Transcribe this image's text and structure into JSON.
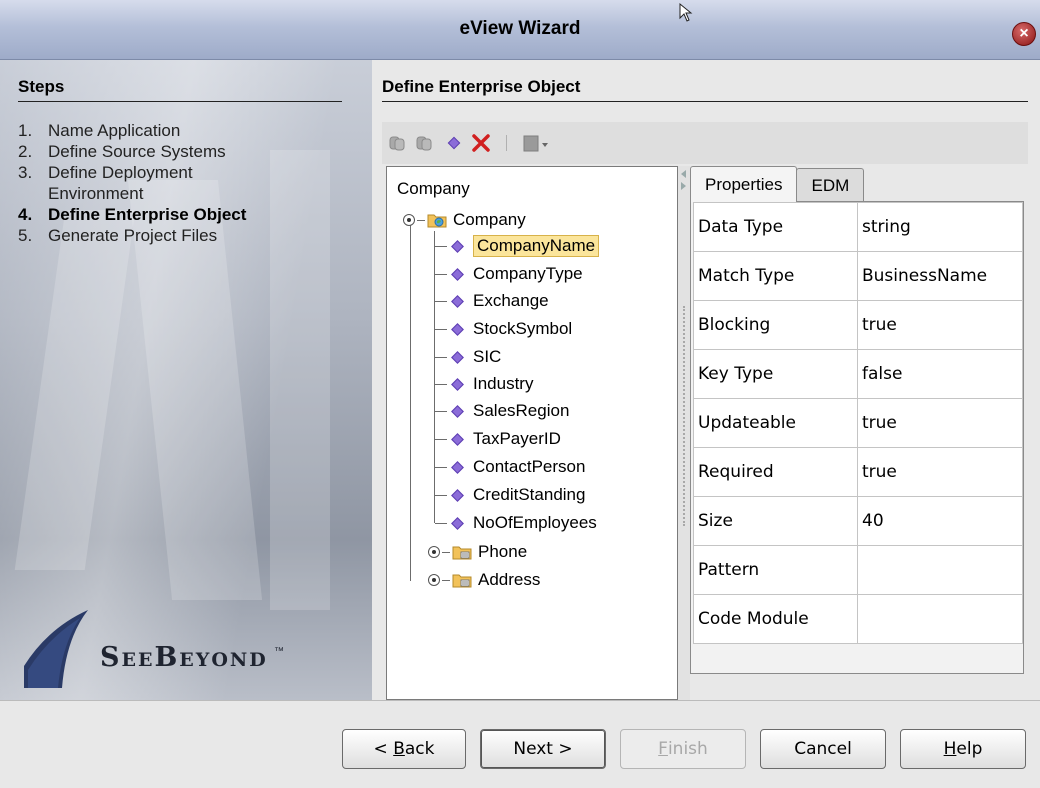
{
  "window": {
    "title": "eView Wizard",
    "close_label": "×"
  },
  "steps": {
    "title": "Steps",
    "items": [
      {
        "num": "1.",
        "label": "Name Application",
        "current": false
      },
      {
        "num": "2.",
        "label": "Define Source Systems",
        "current": false
      },
      {
        "num": "3.",
        "label": "Define Deployment Environment",
        "current": false
      },
      {
        "num": "4.",
        "label": "Define Enterprise Object",
        "current": true
      },
      {
        "num": "5.",
        "label": "Generate Project Files",
        "current": false
      }
    ]
  },
  "logo": {
    "text": "SeeBeyond",
    "trademark": "™"
  },
  "main": {
    "title": "Define Enterprise Object"
  },
  "toolbar": {
    "icons": [
      "add-object-icon",
      "add-sub-object-icon",
      "add-field-icon",
      "delete-icon",
      "templates-icon"
    ]
  },
  "tree": {
    "root_label": "Company",
    "object": "Company",
    "fields": [
      "CompanyName",
      "CompanyType",
      "Exchange",
      "StockSymbol",
      "SIC",
      "Industry",
      "SalesRegion",
      "TaxPayerID",
      "ContactPerson",
      "CreditStanding",
      "NoOfEmployees"
    ],
    "selected": "CompanyName",
    "sub_objects": [
      "Phone",
      "Address"
    ]
  },
  "tabs": [
    {
      "label": "Properties",
      "active": true
    },
    {
      "label": "EDM",
      "active": false
    }
  ],
  "properties": [
    {
      "key": "Data Type",
      "value": "string"
    },
    {
      "key": "Match Type",
      "value": "BusinessName"
    },
    {
      "key": "Blocking",
      "value": "true"
    },
    {
      "key": "Key Type",
      "value": "false"
    },
    {
      "key": "Updateable",
      "value": "true"
    },
    {
      "key": "Required",
      "value": "true"
    },
    {
      "key": "Size",
      "value": "40"
    },
    {
      "key": "Pattern",
      "value": ""
    },
    {
      "key": "Code Module",
      "value": ""
    }
  ],
  "buttons": {
    "back": {
      "pre": "< ",
      "mnemonic": "B",
      "post": "ack"
    },
    "next": {
      "label": "Next >"
    },
    "finish": {
      "mnemonic": "F",
      "post": "inish"
    },
    "cancel": {
      "label": "Cancel"
    },
    "help": {
      "mnemonic": "H",
      "post": "elp"
    }
  },
  "colors": {
    "selection": "#fbe59b",
    "field_diamond": "#8b6cd8",
    "delete_x": "#d12020",
    "titlebar": "#b4bfd8"
  }
}
